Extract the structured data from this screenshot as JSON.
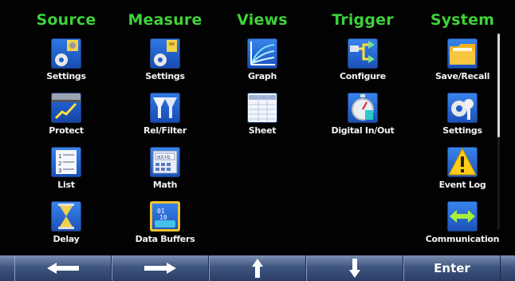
{
  "columns": [
    {
      "title": "Source",
      "items": [
        "Settings",
        "Protect",
        "List",
        "Delay"
      ]
    },
    {
      "title": "Measure",
      "items": [
        "Settings",
        "Rel/Filter",
        "Math",
        "Data Buffers"
      ]
    },
    {
      "title": "Views",
      "items": [
        "Graph",
        "Sheet"
      ]
    },
    {
      "title": "Trigger",
      "items": [
        "Configure",
        "Digital In/Out"
      ]
    },
    {
      "title": "System",
      "items": [
        "Save/Recall",
        "Settings",
        "Event Log",
        "Communication"
      ]
    }
  ],
  "bottom_bar": {
    "left_icon": "arrow-left-icon",
    "right_icon": "arrow-right-icon",
    "up_icon": "arrow-up-icon",
    "down_icon": "arrow-down-icon",
    "enter_label": "Enter"
  },
  "colors": {
    "heading_green": "#3fd13a",
    "icon_blue": "#1f5fd0",
    "bar_blue": "#3f5680"
  }
}
